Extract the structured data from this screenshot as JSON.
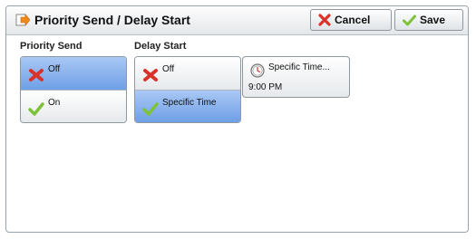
{
  "header": {
    "title": "Priority Send / Delay Start",
    "cancel_label": "Cancel",
    "save_label": "Save"
  },
  "priority_send": {
    "label": "Priority Send",
    "options": [
      {
        "label": "Off",
        "icon": "x-icon",
        "selected": true
      },
      {
        "label": "On",
        "icon": "check-icon",
        "selected": false
      }
    ]
  },
  "delay_start": {
    "label": "Delay Start",
    "options": [
      {
        "label": "Off",
        "icon": "x-icon",
        "selected": false
      },
      {
        "label": "Specific Time",
        "icon": "check-icon",
        "selected": true
      }
    ],
    "specific_time_button": {
      "label": "Specific Time...",
      "value": "9:00 PM",
      "icon": "clock-icon"
    }
  },
  "colors": {
    "selected": "#7aa7ea",
    "x": "#d9322b",
    "check": "#7ec23a"
  }
}
